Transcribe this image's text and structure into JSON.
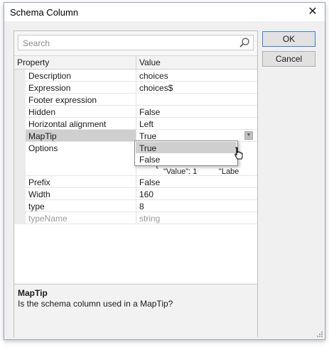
{
  "window": {
    "title": "Schema Column",
    "close_glyph": "✕"
  },
  "search": {
    "placeholder": "Search",
    "icon": "search-icon"
  },
  "grid": {
    "headers": {
      "property": "Property",
      "value": "Value"
    },
    "rows": [
      {
        "name": "Description",
        "value": "choices"
      },
      {
        "name": "Expression",
        "value": "choices$"
      },
      {
        "name": "Footer expression",
        "value": ""
      },
      {
        "name": "Hidden",
        "value": "False"
      },
      {
        "name": "Horizontal alignment",
        "value": "Left"
      },
      {
        "name": "MapTip",
        "value": "True"
      },
      {
        "name": "Options",
        "value": ""
      },
      {
        "name": "Prefix",
        "value": "False"
      },
      {
        "name": "Width",
        "value": "160"
      },
      {
        "name": "type",
        "value": "8"
      },
      {
        "name": "typeName",
        "value": "string"
      }
    ],
    "options_fragments": {
      "brace": "{",
      "text": "\"Value\": 1          \"Labe"
    }
  },
  "dropdown": {
    "options": [
      "True",
      "False"
    ],
    "highlighted": "True"
  },
  "description": {
    "title": "MapTip",
    "text": "Is the schema column used in a MapTip?"
  },
  "buttons": {
    "ok": "OK",
    "cancel": "Cancel"
  }
}
